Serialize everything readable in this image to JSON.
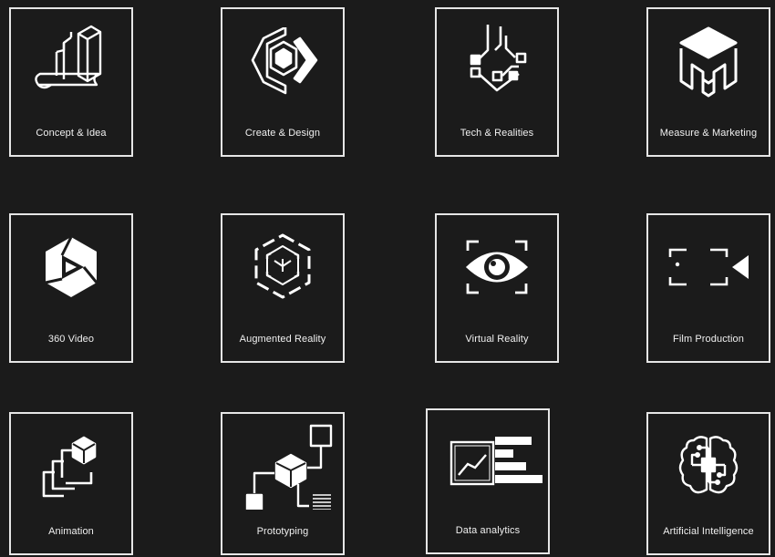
{
  "services": [
    {
      "label": "Concept & Idea",
      "icon": "blueprint-building-icon"
    },
    {
      "label": "Create & Design",
      "icon": "hexagon-design-icon"
    },
    {
      "label": "Tech & Realities",
      "icon": "circuit-board-icon"
    },
    {
      "label": "Measure & Marketing",
      "icon": "cube-m-logo-icon"
    },
    {
      "label": "360 Video",
      "icon": "play-360-icon"
    },
    {
      "label": "Augmented Reality",
      "icon": "ar-cube-icon"
    },
    {
      "label": "Virtual Reality",
      "icon": "eye-frame-icon"
    },
    {
      "label": "Film Production",
      "icon": "camera-frame-icon"
    },
    {
      "label": "Animation",
      "icon": "layered-frames-icon"
    },
    {
      "label": "Prototyping",
      "icon": "prototype-flow-icon"
    },
    {
      "label": "Data analytics",
      "icon": "analytics-chart-icon"
    },
    {
      "label": "Artificial Intelligence",
      "icon": "ai-brain-icon"
    }
  ]
}
